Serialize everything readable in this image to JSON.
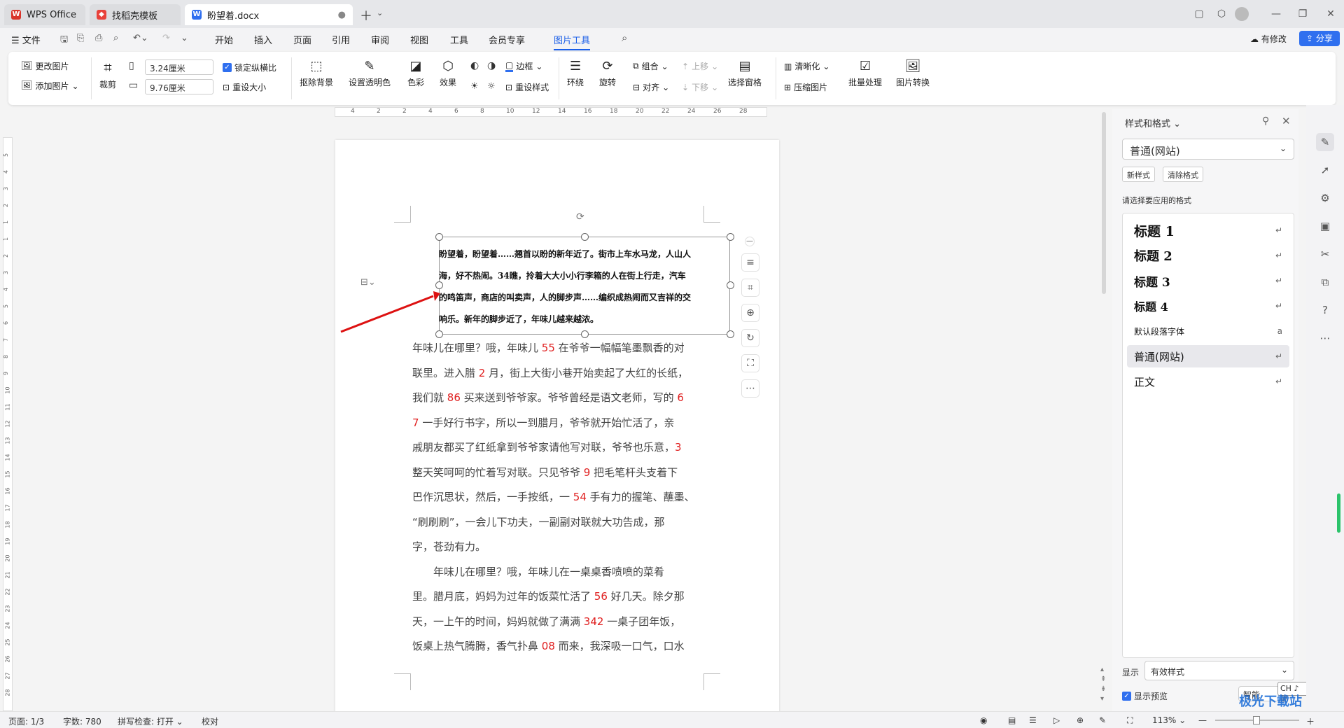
{
  "tabs": [
    {
      "label": "WPS Office",
      "color": "#d9342b"
    },
    {
      "label": "找稻壳模板",
      "color": "#e8413a"
    },
    {
      "label": "盼望着.docx",
      "color": "#2f6fef"
    }
  ],
  "menu": {
    "file": "文件",
    "items": [
      "开始",
      "插入",
      "页面",
      "引用",
      "审阅",
      "视图",
      "工具",
      "会员专享",
      "图片工具"
    ],
    "active": "图片工具",
    "modified": "有修改",
    "share": "分享"
  },
  "ribbon": {
    "change_image": "更改图片",
    "add_image": "添加图片",
    "crop": "裁剪",
    "height": "3.24厘米",
    "width": "9.76厘米",
    "lock_ratio": "锁定纵横比",
    "reset_size": "重设大小",
    "remove_bg": "抠除背景",
    "set_transparent": "设置透明色",
    "color": "色彩",
    "effects": "效果",
    "border": "边框",
    "reset_style": "重设样式",
    "wrap": "环绕",
    "rotate": "旋转",
    "group": "组合",
    "align": "对齐",
    "move_up": "上移",
    "move_down": "下移",
    "selection_pane": "选择窗格",
    "sharpen": "清晰化",
    "compress": "压缩图片",
    "batch": "批量处理",
    "convert": "图片转换"
  },
  "ruler": {
    "h_ticks": [
      "4",
      "2",
      "2",
      "4",
      "6",
      "8",
      "10",
      "12",
      "14",
      "16",
      "18",
      "20",
      "22",
      "24",
      "26",
      "28"
    ],
    "v_ticks": [
      "5",
      "4",
      "3",
      "2",
      "1",
      "1",
      "2",
      "3",
      "4",
      "5",
      "6",
      "7",
      "8",
      "9",
      "10",
      "11",
      "12",
      "13",
      "14",
      "15",
      "16",
      "17",
      "18",
      "19",
      "20",
      "21",
      "22",
      "23",
      "24",
      "25",
      "26",
      "27",
      "28"
    ]
  },
  "document": {
    "image_text": [
      "盼望着，盼望着……翘首以盼的新年近了。街市上车水马龙，人山人",
      "海，好不热闹。34瞧，拎着大大小小行李箱的人在街上行走，汽车",
      "的鸣笛声，商店的叫卖声，人的脚步声……编织成热闹而又吉祥的交",
      "响乐。新年的脚步近了，年味儿越来越浓。"
    ],
    "lines": [
      [
        {
          "t": "年味儿在哪里？哦，年味儿 "
        },
        {
          "t": "55",
          "r": true
        },
        {
          "t": " 在爷爷一幅幅笔墨飘香的对"
        }
      ],
      [
        {
          "t": "联里。进入腊 "
        },
        {
          "t": "2",
          "r": true
        },
        {
          "t": " 月，街上大街小巷开始卖起了大红的长纸，"
        }
      ],
      [
        {
          "t": "我们就 "
        },
        {
          "t": "86",
          "r": true
        },
        {
          "t": " 买来送到爷爷家。爷爷曾经是语文老师，写的 "
        },
        {
          "t": "6",
          "r": true
        }
      ],
      [
        {
          "t": "7",
          "r": true
        },
        {
          "t": " 一手好行书字，所以一到腊月，爷爷就开始忙活了，亲"
        }
      ],
      [
        {
          "t": "戚朋友都买了红纸拿到爷爷家请他写对联，爷爷也乐意，"
        },
        {
          "t": "3",
          "r": true
        }
      ],
      [
        {
          "t": "整天笑呵呵的忙着写对联。只见爷爷 "
        },
        {
          "t": "9",
          "r": true
        },
        {
          "t": " 把毛笔杆头支着下"
        }
      ],
      [
        {
          "t": "巴作沉思状，然后，一手按纸，一 "
        },
        {
          "t": "54",
          "r": true
        },
        {
          "t": " 手有力的握笔、蘸墨、"
        }
      ],
      [
        {
          "t": "“刷刷刷”，一会儿下功夫，一副副对联就大功告成，那"
        }
      ],
      [
        {
          "t": "字，苍劲有力。"
        }
      ],
      [
        {
          "t": "　　年味儿在哪里？哦，年味儿在一桌桌香喷喷的菜肴"
        }
      ],
      [
        {
          "t": "里。腊月底，妈妈为过年的饭菜忙活了 "
        },
        {
          "t": "56",
          "r": true
        },
        {
          "t": " 好几天。除夕那"
        }
      ],
      [
        {
          "t": "天，一上午的时间，妈妈就做了满满 "
        },
        {
          "t": "342",
          "r": true
        },
        {
          "t": " 一桌子团年饭，"
        }
      ],
      [
        {
          "t": "饭桌上热气腾腾，香气扑鼻 "
        },
        {
          "t": "08",
          "r": true
        },
        {
          "t": " 而来，我深吸一口气，口水"
        }
      ]
    ]
  },
  "panel": {
    "title": "样式和格式",
    "current_style": "普通(网站)",
    "new_style": "新样式",
    "clear_format": "清除格式",
    "prompt": "请选择要应用的格式",
    "styles": [
      {
        "label": "标题 1",
        "size": "19px",
        "bold": true
      },
      {
        "label": "标题 2",
        "size": "18px",
        "bold": true
      },
      {
        "label": "标题 3",
        "size": "17px",
        "bold": true
      },
      {
        "label": "标题 4",
        "size": "16px",
        "bold": true
      },
      {
        "label": "默认段落字体",
        "size": "12px",
        "bold": false
      },
      {
        "label": "普通(网站)",
        "size": "15px",
        "bold": false,
        "selected": true
      },
      {
        "label": "正文",
        "size": "15px",
        "bold": false
      }
    ],
    "show_label": "显示",
    "show_value": "有效样式",
    "preview_label": "显示预览",
    "ime": "CH ♪ 简",
    "smart": "智能"
  },
  "status": {
    "page": "页面: 1/3",
    "words": "字数: 780",
    "spell": "拼写检查: 打开",
    "proof": "校对",
    "zoom": "113%"
  },
  "watermark": "极光下载站"
}
